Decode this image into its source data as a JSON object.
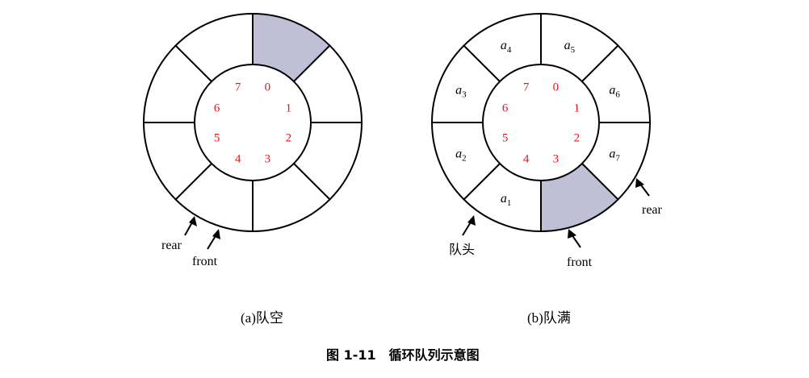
{
  "diagram_a": {
    "caption": "(a)队空",
    "indices": [
      "0",
      "1",
      "2",
      "3",
      "4",
      "5",
      "6",
      "7"
    ],
    "shaded_slot": 0,
    "pointers": {
      "rear": "rear",
      "front": "front"
    }
  },
  "diagram_b": {
    "caption": "(b)队满",
    "indices": [
      "0",
      "1",
      "2",
      "3",
      "4",
      "5",
      "6",
      "7"
    ],
    "shaded_slot": 3,
    "elements": [
      {
        "slot": 0,
        "base": "a",
        "sub": "5"
      },
      {
        "slot": 1,
        "base": "a",
        "sub": "6"
      },
      {
        "slot": 2,
        "base": "a",
        "sub": "7"
      },
      {
        "slot": 4,
        "base": "a",
        "sub": "1"
      },
      {
        "slot": 5,
        "base": "a",
        "sub": "2"
      },
      {
        "slot": 6,
        "base": "a",
        "sub": "3"
      },
      {
        "slot": 7,
        "base": "a",
        "sub": "4"
      }
    ],
    "pointers": {
      "rear": "rear",
      "front": "front",
      "head": "队头"
    }
  },
  "figure_caption": "图 1-11　循环队列示意图",
  "colors": {
    "shaded": "#bfc0d6",
    "index": "#e8141d",
    "stroke": "#000000"
  }
}
